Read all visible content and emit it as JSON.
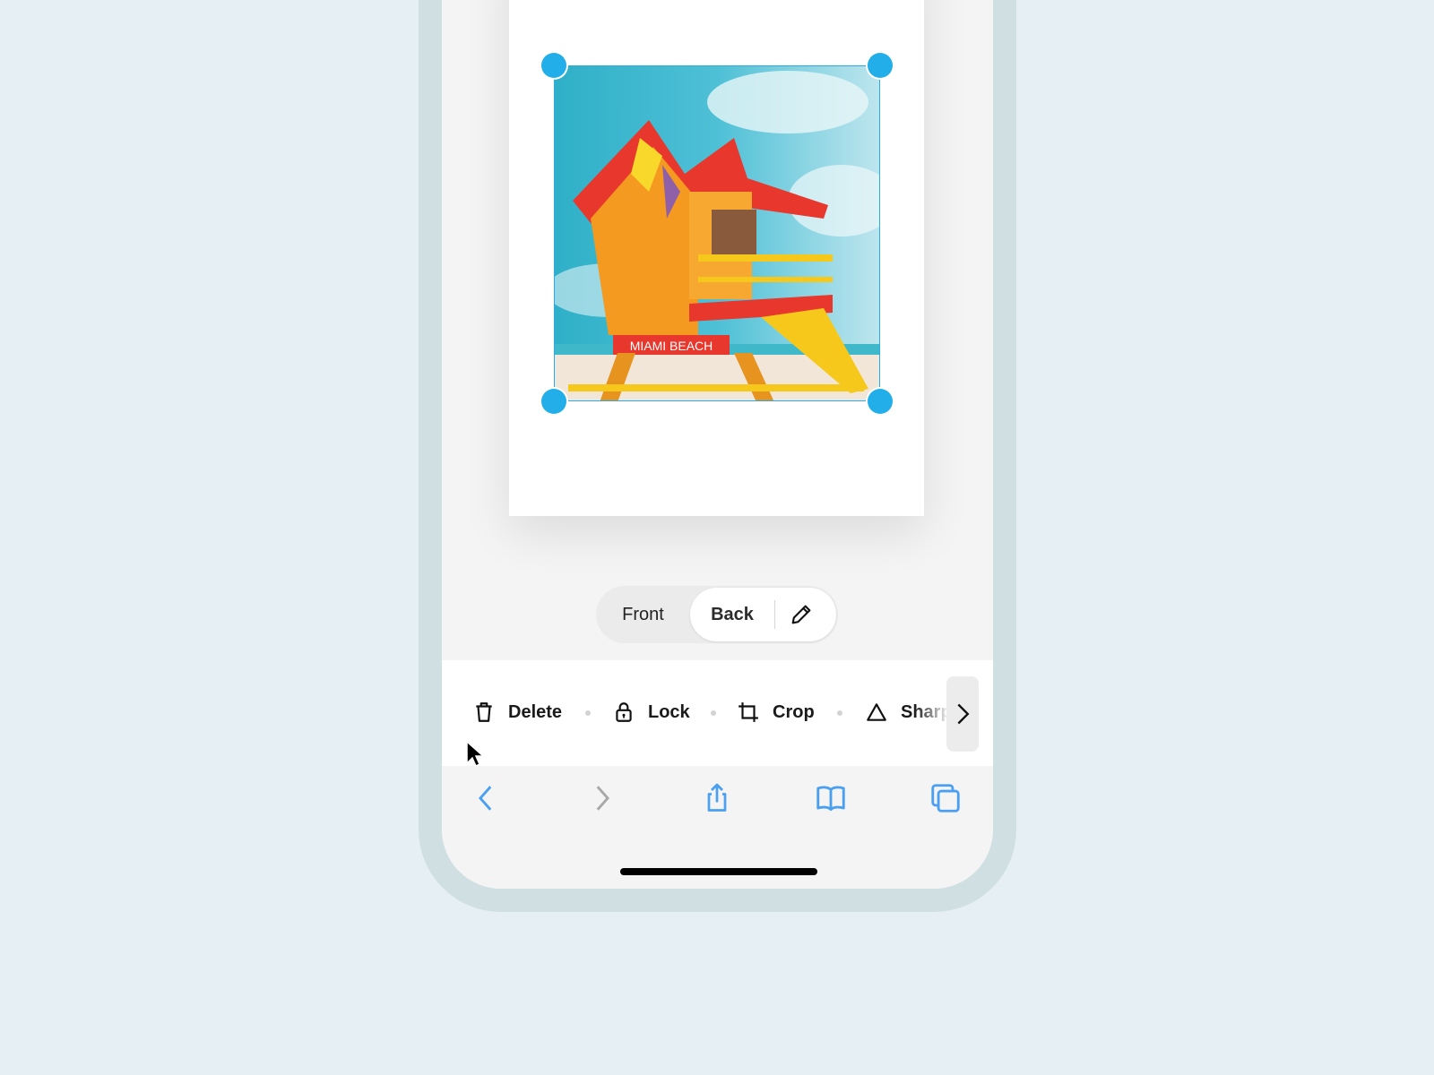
{
  "canvas": {
    "image_description": "Miami Beach lifeguard tower photo",
    "sign_text": "MIAMI BEACH",
    "selection_color": "#22aee8"
  },
  "side_toggle": {
    "front_label": "Front",
    "back_label": "Back",
    "selected": "Back",
    "edit_icon": "pencil-icon"
  },
  "actions": [
    {
      "label": "Delete",
      "icon": "trash-icon"
    },
    {
      "label": "Lock",
      "icon": "lock-icon"
    },
    {
      "label": "Crop",
      "icon": "crop-icon"
    },
    {
      "label": "Sharp",
      "icon": "triangle-icon"
    }
  ],
  "action_scroll_icon": "chevron-right-icon",
  "browser_nav": [
    {
      "name": "back",
      "icon": "chevron-left-icon",
      "enabled": true
    },
    {
      "name": "forward",
      "icon": "chevron-right-icon",
      "enabled": false
    },
    {
      "name": "share",
      "icon": "share-icon",
      "enabled": true
    },
    {
      "name": "bookmarks",
      "icon": "book-icon",
      "enabled": true
    },
    {
      "name": "tabs",
      "icon": "tabs-icon",
      "enabled": true
    }
  ],
  "colors": {
    "accent_blue": "#4a9ff0",
    "disabled_gray": "#a8a8a8",
    "handle_blue": "#22aee8"
  }
}
